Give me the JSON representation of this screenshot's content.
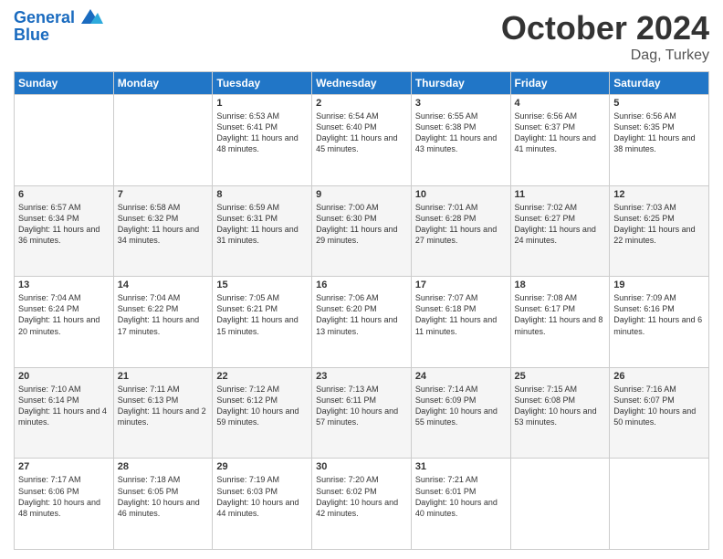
{
  "header": {
    "logo_line1": "General",
    "logo_line2": "Blue",
    "month": "October 2024",
    "location": "Dag, Turkey"
  },
  "weekdays": [
    "Sunday",
    "Monday",
    "Tuesday",
    "Wednesday",
    "Thursday",
    "Friday",
    "Saturday"
  ],
  "weeks": [
    [
      {
        "day": "",
        "sunrise": "",
        "sunset": "",
        "daylight": ""
      },
      {
        "day": "",
        "sunrise": "",
        "sunset": "",
        "daylight": ""
      },
      {
        "day": "1",
        "sunrise": "Sunrise: 6:53 AM",
        "sunset": "Sunset: 6:41 PM",
        "daylight": "Daylight: 11 hours and 48 minutes."
      },
      {
        "day": "2",
        "sunrise": "Sunrise: 6:54 AM",
        "sunset": "Sunset: 6:40 PM",
        "daylight": "Daylight: 11 hours and 45 minutes."
      },
      {
        "day": "3",
        "sunrise": "Sunrise: 6:55 AM",
        "sunset": "Sunset: 6:38 PM",
        "daylight": "Daylight: 11 hours and 43 minutes."
      },
      {
        "day": "4",
        "sunrise": "Sunrise: 6:56 AM",
        "sunset": "Sunset: 6:37 PM",
        "daylight": "Daylight: 11 hours and 41 minutes."
      },
      {
        "day": "5",
        "sunrise": "Sunrise: 6:56 AM",
        "sunset": "Sunset: 6:35 PM",
        "daylight": "Daylight: 11 hours and 38 minutes."
      }
    ],
    [
      {
        "day": "6",
        "sunrise": "Sunrise: 6:57 AM",
        "sunset": "Sunset: 6:34 PM",
        "daylight": "Daylight: 11 hours and 36 minutes."
      },
      {
        "day": "7",
        "sunrise": "Sunrise: 6:58 AM",
        "sunset": "Sunset: 6:32 PM",
        "daylight": "Daylight: 11 hours and 34 minutes."
      },
      {
        "day": "8",
        "sunrise": "Sunrise: 6:59 AM",
        "sunset": "Sunset: 6:31 PM",
        "daylight": "Daylight: 11 hours and 31 minutes."
      },
      {
        "day": "9",
        "sunrise": "Sunrise: 7:00 AM",
        "sunset": "Sunset: 6:30 PM",
        "daylight": "Daylight: 11 hours and 29 minutes."
      },
      {
        "day": "10",
        "sunrise": "Sunrise: 7:01 AM",
        "sunset": "Sunset: 6:28 PM",
        "daylight": "Daylight: 11 hours and 27 minutes."
      },
      {
        "day": "11",
        "sunrise": "Sunrise: 7:02 AM",
        "sunset": "Sunset: 6:27 PM",
        "daylight": "Daylight: 11 hours and 24 minutes."
      },
      {
        "day": "12",
        "sunrise": "Sunrise: 7:03 AM",
        "sunset": "Sunset: 6:25 PM",
        "daylight": "Daylight: 11 hours and 22 minutes."
      }
    ],
    [
      {
        "day": "13",
        "sunrise": "Sunrise: 7:04 AM",
        "sunset": "Sunset: 6:24 PM",
        "daylight": "Daylight: 11 hours and 20 minutes."
      },
      {
        "day": "14",
        "sunrise": "Sunrise: 7:04 AM",
        "sunset": "Sunset: 6:22 PM",
        "daylight": "Daylight: 11 hours and 17 minutes."
      },
      {
        "day": "15",
        "sunrise": "Sunrise: 7:05 AM",
        "sunset": "Sunset: 6:21 PM",
        "daylight": "Daylight: 11 hours and 15 minutes."
      },
      {
        "day": "16",
        "sunrise": "Sunrise: 7:06 AM",
        "sunset": "Sunset: 6:20 PM",
        "daylight": "Daylight: 11 hours and 13 minutes."
      },
      {
        "day": "17",
        "sunrise": "Sunrise: 7:07 AM",
        "sunset": "Sunset: 6:18 PM",
        "daylight": "Daylight: 11 hours and 11 minutes."
      },
      {
        "day": "18",
        "sunrise": "Sunrise: 7:08 AM",
        "sunset": "Sunset: 6:17 PM",
        "daylight": "Daylight: 11 hours and 8 minutes."
      },
      {
        "day": "19",
        "sunrise": "Sunrise: 7:09 AM",
        "sunset": "Sunset: 6:16 PM",
        "daylight": "Daylight: 11 hours and 6 minutes."
      }
    ],
    [
      {
        "day": "20",
        "sunrise": "Sunrise: 7:10 AM",
        "sunset": "Sunset: 6:14 PM",
        "daylight": "Daylight: 11 hours and 4 minutes."
      },
      {
        "day": "21",
        "sunrise": "Sunrise: 7:11 AM",
        "sunset": "Sunset: 6:13 PM",
        "daylight": "Daylight: 11 hours and 2 minutes."
      },
      {
        "day": "22",
        "sunrise": "Sunrise: 7:12 AM",
        "sunset": "Sunset: 6:12 PM",
        "daylight": "Daylight: 10 hours and 59 minutes."
      },
      {
        "day": "23",
        "sunrise": "Sunrise: 7:13 AM",
        "sunset": "Sunset: 6:11 PM",
        "daylight": "Daylight: 10 hours and 57 minutes."
      },
      {
        "day": "24",
        "sunrise": "Sunrise: 7:14 AM",
        "sunset": "Sunset: 6:09 PM",
        "daylight": "Daylight: 10 hours and 55 minutes."
      },
      {
        "day": "25",
        "sunrise": "Sunrise: 7:15 AM",
        "sunset": "Sunset: 6:08 PM",
        "daylight": "Daylight: 10 hours and 53 minutes."
      },
      {
        "day": "26",
        "sunrise": "Sunrise: 7:16 AM",
        "sunset": "Sunset: 6:07 PM",
        "daylight": "Daylight: 10 hours and 50 minutes."
      }
    ],
    [
      {
        "day": "27",
        "sunrise": "Sunrise: 7:17 AM",
        "sunset": "Sunset: 6:06 PM",
        "daylight": "Daylight: 10 hours and 48 minutes."
      },
      {
        "day": "28",
        "sunrise": "Sunrise: 7:18 AM",
        "sunset": "Sunset: 6:05 PM",
        "daylight": "Daylight: 10 hours and 46 minutes."
      },
      {
        "day": "29",
        "sunrise": "Sunrise: 7:19 AM",
        "sunset": "Sunset: 6:03 PM",
        "daylight": "Daylight: 10 hours and 44 minutes."
      },
      {
        "day": "30",
        "sunrise": "Sunrise: 7:20 AM",
        "sunset": "Sunset: 6:02 PM",
        "daylight": "Daylight: 10 hours and 42 minutes."
      },
      {
        "day": "31",
        "sunrise": "Sunrise: 7:21 AM",
        "sunset": "Sunset: 6:01 PM",
        "daylight": "Daylight: 10 hours and 40 minutes."
      },
      {
        "day": "",
        "sunrise": "",
        "sunset": "",
        "daylight": ""
      },
      {
        "day": "",
        "sunrise": "",
        "sunset": "",
        "daylight": ""
      }
    ]
  ]
}
